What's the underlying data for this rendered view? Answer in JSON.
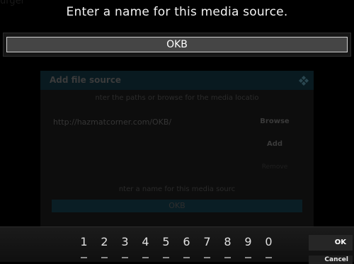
{
  "dialog": {
    "title": "Enter a name for this media source.",
    "input_value": "OKB"
  },
  "background": {
    "faint_top_text": "urger",
    "title": "Add file source",
    "subtitle": "nter the paths or browse for the media locatio",
    "path": "http://hazmatcorner.com/OKB/",
    "browse_label": "Browse",
    "add_label": "Add",
    "remove_label": "Remove",
    "name_label": "nter a name for this media sourc",
    "name_value": "OKB"
  },
  "keyboard": {
    "keys": [
      "1",
      "2",
      "3",
      "4",
      "5",
      "6",
      "7",
      "8",
      "9",
      "0"
    ],
    "ok_label": "OK",
    "cancel_label": "Cancel"
  }
}
